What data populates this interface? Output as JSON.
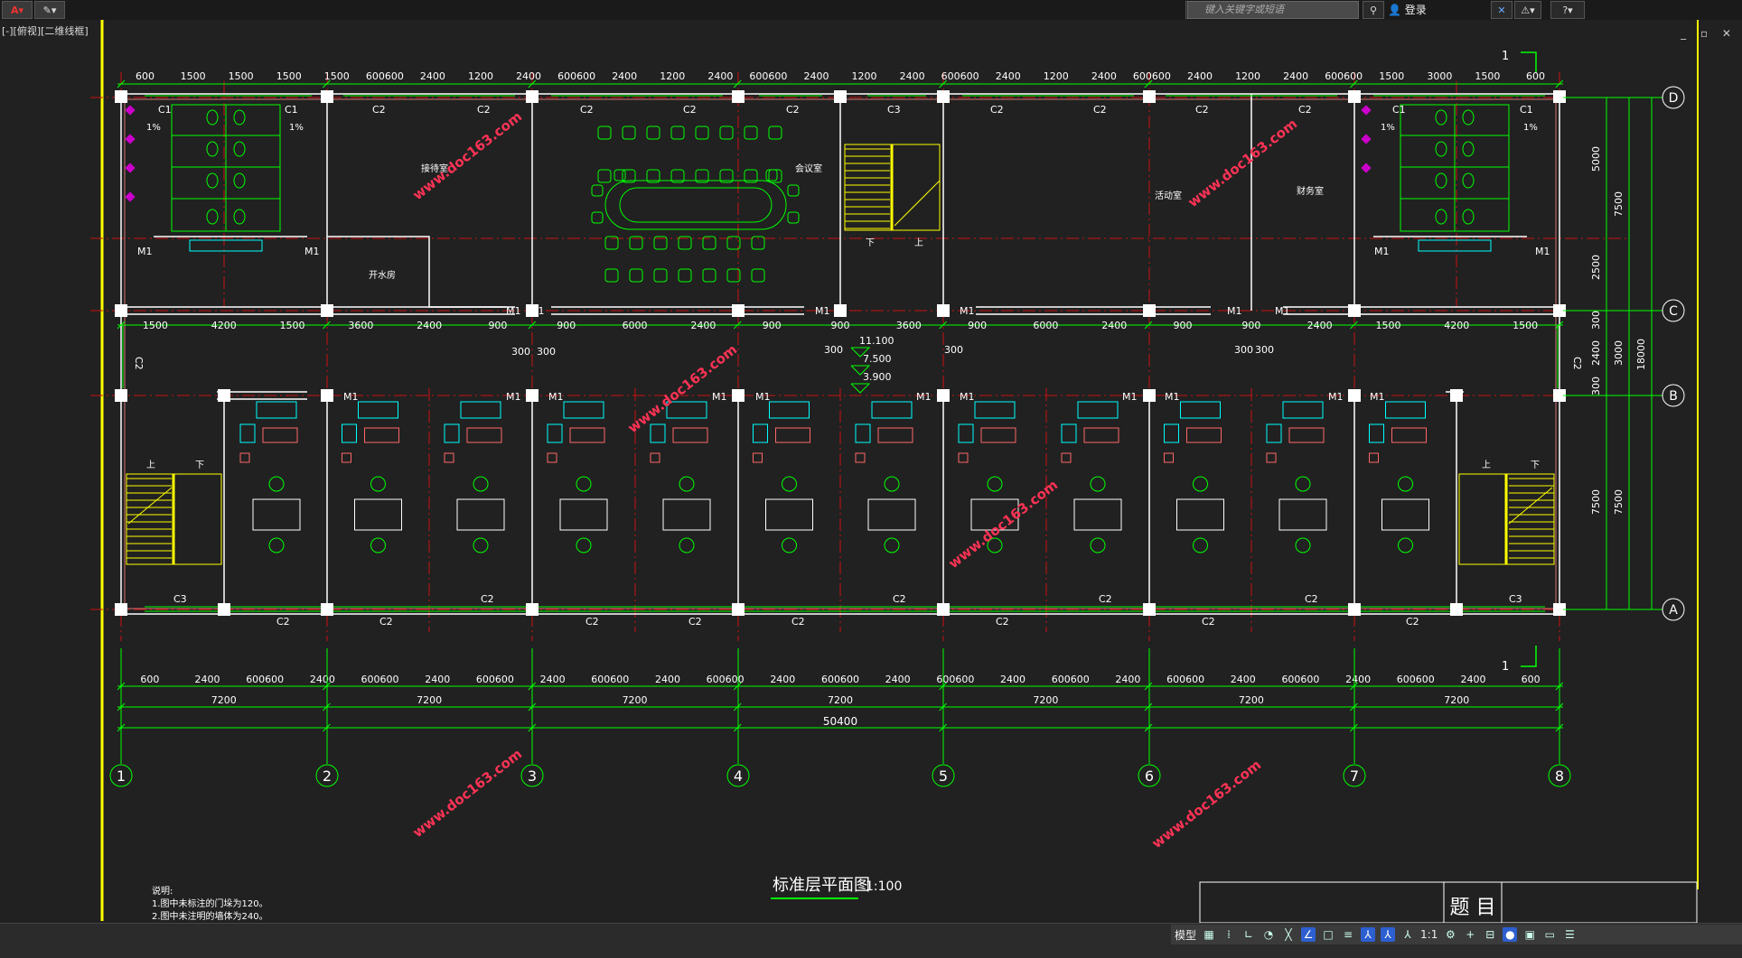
{
  "app": {
    "search_placeholder": "键入关键字或短语",
    "login_label": "登录",
    "viewport_label": "[-][俯视][二维线框]",
    "window_controls": "_ ▫ ✕"
  },
  "drawing": {
    "title": "标准层平面图",
    "scale": "1:100",
    "notes_title": "说明:",
    "note1": "1.图中未标注的门垛为120。",
    "note2": "2.图中未注明的墙体为240。",
    "title_block_label": "题 目",
    "top_dims": [
      "600",
      "1500",
      "1500",
      "1500",
      "1500",
      "600600",
      "2400",
      "1200",
      "2400",
      "600600",
      "2400",
      "1200",
      "2400",
      "600600",
      "2400",
      "1200",
      "2400",
      "600600",
      "2400",
      "1200",
      "2400",
      "600600",
      "2400",
      "1200",
      "2400",
      "600600",
      "1500",
      "3000",
      "1500",
      "600"
    ],
    "mid_dims": [
      "1500",
      "4200",
      "1500",
      "3600",
      "2400",
      "900",
      "900",
      "6000",
      "2400",
      "900",
      "900",
      "3600",
      "900",
      "6000",
      "2400",
      "900",
      "900",
      "2400",
      "1500",
      "4200",
      "1500"
    ],
    "bottom_dims": [
      "600",
      "2400",
      "600600",
      "2400",
      "600600",
      "2400",
      "600600",
      "2400",
      "600600",
      "2400",
      "600600",
      "2400",
      "600600",
      "2400",
      "600600",
      "2400",
      "600600",
      "2400",
      "600600",
      "2400",
      "600600",
      "2400",
      "600600",
      "2400",
      "600"
    ],
    "bay_dims": [
      "7200",
      "7200",
      "7200",
      "7200",
      "7200",
      "7200",
      "7200"
    ],
    "total_dim": "50400",
    "axis_numbers": [
      "1",
      "2",
      "3",
      "4",
      "5",
      "6",
      "7",
      "8"
    ],
    "axis_letters": [
      "D",
      "C",
      "B",
      "A"
    ],
    "right_dims": {
      "d1": "5000",
      "d2": "2500",
      "d3": "7500",
      "d4": "300",
      "d5": "2400",
      "d6": "3000",
      "d7": "300",
      "d8": "7500",
      "d9": "7500",
      "total": "18000"
    },
    "elevations": [
      "11.100",
      "7.500",
      "3.900"
    ],
    "corridor_300": "300",
    "rooms": {
      "reception": "接待室",
      "meeting": "会议室",
      "water": "开水房",
      "activity": "活动室",
      "finance": "财务室"
    },
    "stair_up": "上",
    "stair_down": "下",
    "slope": "1%",
    "section_mark": "1",
    "watermark": "www.doc163.com",
    "labels": {
      "c1": "C1",
      "c2": "C2",
      "c3": "C3",
      "m1": "M1"
    }
  },
  "status": {
    "model_tab": "模型",
    "scale_value": "1:1"
  }
}
